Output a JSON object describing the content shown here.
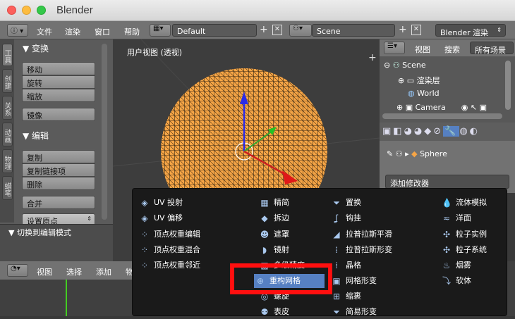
{
  "window": {
    "title": "Blender"
  },
  "header": {
    "menus": [
      "文件",
      "渲染",
      "窗口",
      "帮助"
    ],
    "screen_layout": "Default",
    "scene": "Scene",
    "engine": "Blender 渲染"
  },
  "toolbar": {
    "tabs": [
      "工具",
      "创建",
      "关系",
      "动画",
      "物理",
      "蜡笔"
    ],
    "transform_header": "▼ 变换",
    "transform": [
      "移动",
      "旋转",
      "缩放"
    ],
    "mirror": "镜像",
    "edit_header": "▼ 编辑",
    "edit": [
      "复制",
      "复制链接项",
      "删除"
    ],
    "join": "合并",
    "set_origin": "设置原点",
    "toggle_edit": "▼ 切换到编辑模式"
  },
  "viewport": {
    "label": "用户视图 (透视)"
  },
  "outliner": {
    "view": "视图",
    "search": "搜索",
    "filter": "所有场景",
    "items": [
      "Scene",
      "渲染层",
      "World",
      "Camera"
    ]
  },
  "properties": {
    "object": "Sphere",
    "add_modifier": "添加修改器"
  },
  "timeline": {
    "menus": [
      "视图",
      "选择",
      "添加",
      "物"
    ]
  },
  "modifier_menu": {
    "col1": [
      "UV 投射",
      "UV 偏移",
      "顶点权重编辑",
      "顶点权重混合",
      "顶点权重邻近"
    ],
    "col2": [
      "精简",
      "拆边",
      "遮罩",
      "镜射",
      "多级精度",
      "重构网格",
      "螺旋",
      "表皮"
    ],
    "col3": [
      "置换",
      "钩挂",
      "拉普拉斯平滑",
      "拉普拉斯形变",
      "晶格",
      "网格形变",
      "缩裹",
      "简易形变"
    ],
    "col4": [
      "流体模拟",
      "洋面",
      "粒子实例",
      "粒子系统",
      "烟雾",
      "软体"
    ]
  }
}
